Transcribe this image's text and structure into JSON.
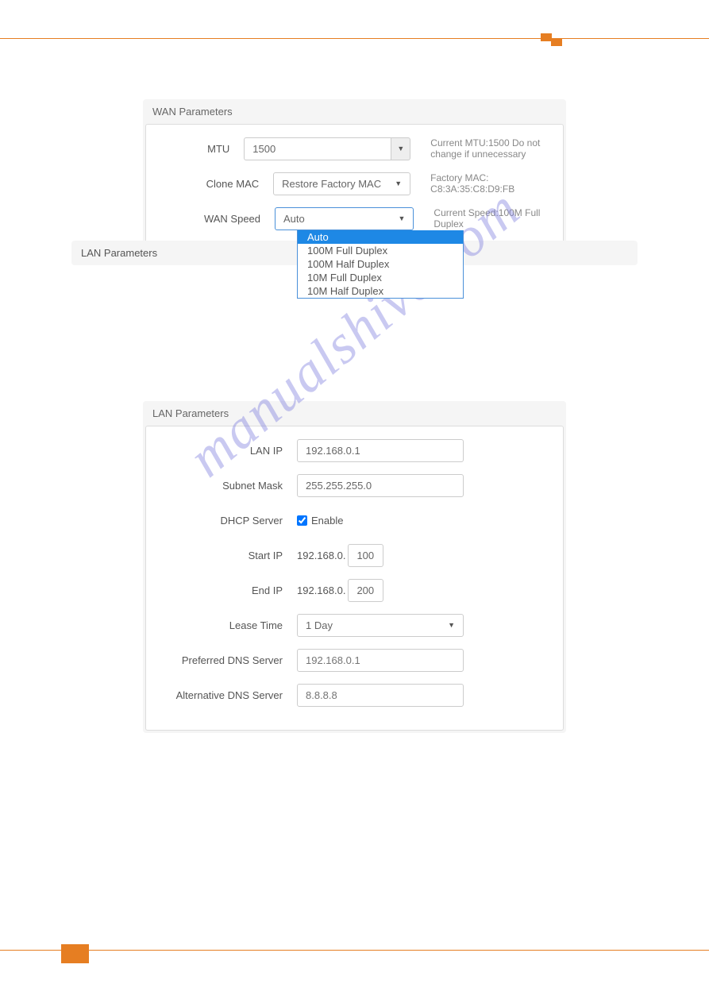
{
  "wan": {
    "title": "WAN Parameters",
    "mtu": {
      "label": "MTU",
      "value": "1500",
      "help": "Current MTU:1500 Do not change if unnecessary"
    },
    "cloneMac": {
      "label": "Clone MAC",
      "selected": "Restore Factory MAC",
      "help": "Factory MAC: C8:3A:35:C8:D9:FB"
    },
    "wanSpeed": {
      "label": "WAN Speed",
      "selected": "Auto",
      "help": "Current Speed:100M Full Duplex",
      "options": [
        "Auto",
        "100M Full Duplex",
        "100M Half Duplex",
        "10M Full Duplex",
        "10M Half Duplex"
      ]
    }
  },
  "lanHeader": {
    "title": "LAN Parameters"
  },
  "lan": {
    "title": "LAN Parameters",
    "lanIp": {
      "label": "LAN IP",
      "value": "192.168.0.1"
    },
    "subnetMask": {
      "label": "Subnet Mask",
      "value": "255.255.255.0"
    },
    "dhcpServer": {
      "label": "DHCP Server",
      "enableLabel": "Enable"
    },
    "startIp": {
      "label": "Start IP",
      "prefix": "192.168.0.",
      "value": "100"
    },
    "endIp": {
      "label": "End IP",
      "prefix": "192.168.0.",
      "value": "200"
    },
    "leaseTime": {
      "label": "Lease Time",
      "selected": "1 Day"
    },
    "preferredDns": {
      "label": "Preferred DNS Server",
      "placeholder": "192.168.0.1"
    },
    "altDns": {
      "label": "Alternative DNS Server",
      "placeholder": "8.8.8.8"
    }
  },
  "watermark": "manualshive.com"
}
